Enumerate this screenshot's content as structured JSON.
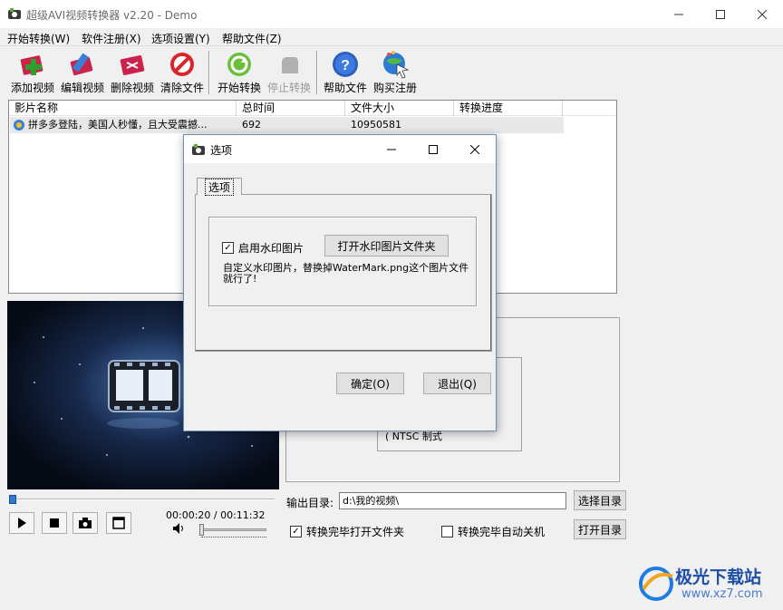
{
  "window": {
    "title": "超级AVI视频转换器 v2.20 - Demo"
  },
  "menu": [
    "开始转换(W)",
    "软件注册(X)",
    "选项设置(Y)",
    "帮助文件(Z)"
  ],
  "toolbar": {
    "add_video": "添加视频",
    "edit_video": "编辑视频",
    "delete_video": "删除视频",
    "clear_files": "清除文件",
    "start_convert": "开始转换",
    "stop_convert": "停止转换",
    "help_file": "帮助文件",
    "buy_register": "购买注册"
  },
  "file_list": {
    "columns": [
      "影片名称",
      "总时间",
      "文件大小",
      "转换进度"
    ],
    "rows": [
      {
        "name": "拼多多登陆，美国人秒懂，且大受震撼...",
        "duration": "692",
        "size": "10950581",
        "progress": ""
      }
    ]
  },
  "player": {
    "time": "00:00:20 / 00:11:32"
  },
  "output": {
    "label": "输出目录:",
    "path": "d:\\我的视频\\",
    "choose_dir": "选择目录",
    "open_dir": "打开目录",
    "open_folder_after": "转换完毕打开文件夹",
    "open_folder_after_checked": true,
    "shutdown_after": "转换完毕自动关机",
    "shutdown_after_checked": false
  },
  "video_standard": {
    "ntsc": "NTSC 制式"
  },
  "dialog": {
    "title": "选项",
    "tab": "选项",
    "enable_watermark": "启用水印图片",
    "enable_watermark_checked": true,
    "open_watermark_folder": "打开水印图片文件夹",
    "note": "自定义水印图片，替换掉WaterMark.png这个图片文件就行了!",
    "ok": "确定(O)",
    "exit": "退出(Q)"
  },
  "watermark": {
    "brand": "极光下载站",
    "url": "www.xz7.com"
  },
  "colors": {
    "accent": "#1e4fa6",
    "list_selected_row": "#e8e8e8",
    "preview_bg": "#070d18"
  }
}
